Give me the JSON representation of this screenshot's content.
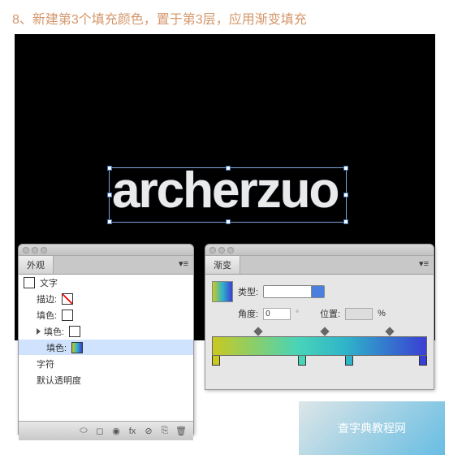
{
  "step_title": "8、新建第3个填充颜色，置于第3层，应用渐变填充",
  "canvas_text": "archerzuo",
  "appearance": {
    "tab": "外观",
    "collapse": "▾≡",
    "header": "文字",
    "rows": {
      "stroke": "描边:",
      "fill1": "填色:",
      "fill2": "填色:",
      "fill3": "填色:",
      "char": "字符",
      "opacity": "默认透明度"
    }
  },
  "gradient": {
    "tab": "渐变",
    "type_label": "类型:",
    "angle_label": "角度:",
    "angle_value": "0",
    "pos_label": "位置:",
    "pos_unit": "%"
  },
  "watermark": "查字典教程网",
  "chart_data": {
    "type": "gradient",
    "stops": [
      {
        "position": 0,
        "color": "#c9c921"
      },
      {
        "position": 40,
        "color": "#48d4b8"
      },
      {
        "position": 62,
        "color": "#2fb4c9"
      },
      {
        "position": 100,
        "color": "#3a3fd3"
      }
    ],
    "midpoints": [
      20,
      51,
      81
    ],
    "angle": 0
  }
}
